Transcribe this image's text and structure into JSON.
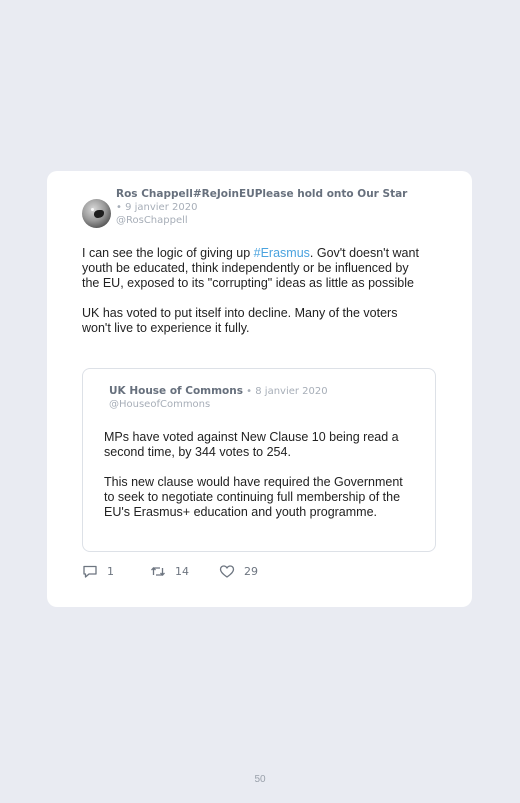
{
  "tweet": {
    "author_name": "Ros Chappell#ReJoinEUPlease hold onto Our Star",
    "date": " • 9 janvier 2020",
    "handle": "@RosChappell",
    "text_before_hashtag": "I can see the logic of giving up ",
    "hashtag": "#Erasmus",
    "text_after_hashtag": ". Gov't doesn't want youth be educated, think independently or be influenced by the EU, exposed to its \"corrupting\" ideas as little as possible",
    "paragraph_2": "UK has voted to put itself into decline. Many of the voters won't live to experience it fully.",
    "replies": "1",
    "retweets": "14",
    "likes": "29"
  },
  "quoted_tweet": {
    "author_name": "UK House of Commons",
    "date": " • 8 janvier 2020",
    "handle": "@HouseofCommons",
    "paragraph_1": "MPs have voted against New Clause 10 being read a second time, by 344 votes to 254.",
    "paragraph_2": "This new clause would have required the Government to seek to negotiate continuing full membership of the EU's Erasmus+ education and youth programme."
  },
  "page_number": "50",
  "colors": {
    "background": "#e9ebf2",
    "card": "#ffffff",
    "hashtag": "#4aa3df",
    "icon": "#6d7580"
  },
  "icons": [
    "reply-icon",
    "retweet-icon",
    "like-icon"
  ]
}
